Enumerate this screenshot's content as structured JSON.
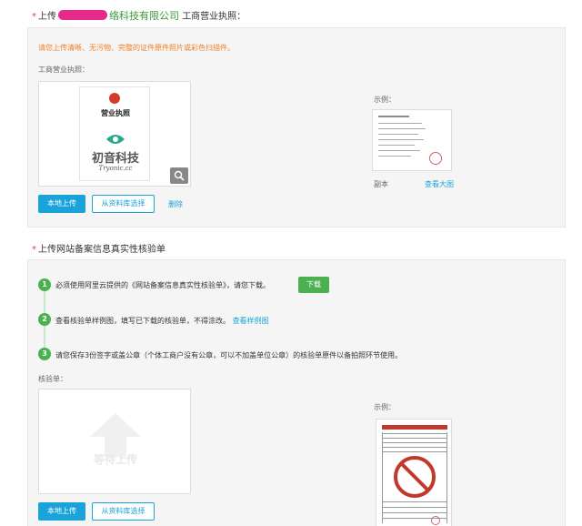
{
  "section1": {
    "required_mark": "*",
    "title_prefix": "上传",
    "company_suffix": "络科技有限公司",
    "title_suffix": "工商营业执照：",
    "notice": "请您上传清晰、无污物、完整的证件原件照片或彩色扫描件。",
    "field_label": "工商营业执照：",
    "license_header": "营业执照",
    "license_company": "初音科技",
    "license_domain": "Tryonic.cc",
    "upload_button": "本地上传",
    "library_button": "从资料库选择",
    "delete_link": "删除",
    "example_label": "示例：",
    "example_caption": "副本",
    "view_large_link": "查看大图"
  },
  "section2": {
    "required_mark": "*",
    "title": "上传网站备案信息真实性核验单",
    "step1_num": "1",
    "step1_text": "必须使用阿里云提供的《网站备案信息真实性核验单》，请您下载。",
    "download_button": "下载",
    "step2_num": "2",
    "step2_text": "查看核验单样例图，填写已下载的核验单，不得涂改。",
    "step2_link": "查看样例图",
    "step3_num": "3",
    "step3_text": "请您保存3份签字或盖公章（个体工商户没有公章，可以不加盖单位公章）的核验单原件以备拍照环节使用。",
    "field_label": "核验单：",
    "placeholder_text": "等待上传",
    "upload_button": "本地上传",
    "library_button": "从资料库选择",
    "example_label": "示例："
  },
  "colors": {
    "accent": "#1aa3d9",
    "green": "#4cb050",
    "notice": "#f0822a",
    "company": "#3a9a3a",
    "redaction": "#e82a8c"
  }
}
